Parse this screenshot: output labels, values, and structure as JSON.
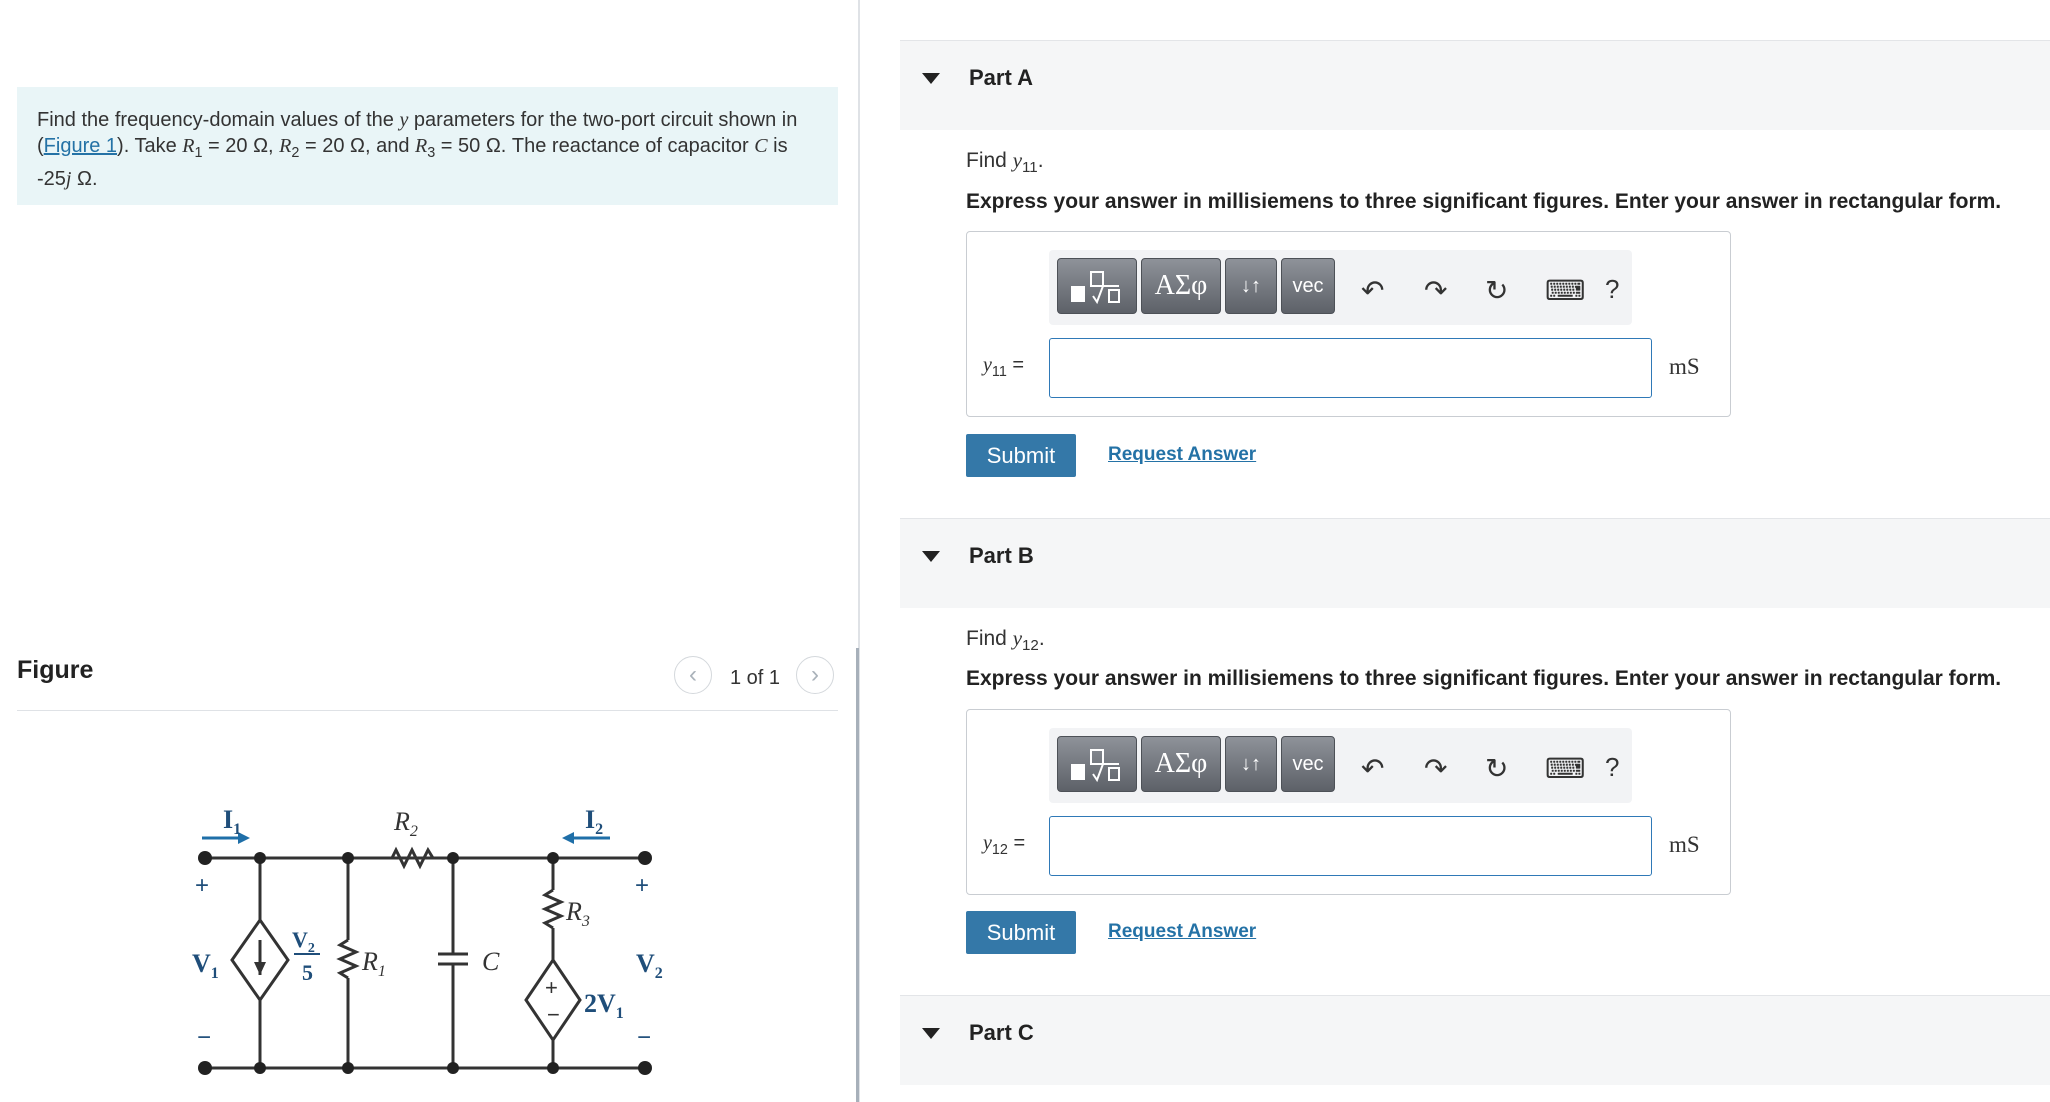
{
  "problem": {
    "text_1": "Find the frequency-domain values of the ",
    "y_symbol": "y",
    "text_2": " parameters for the two-port circuit shown in (",
    "figure_link": "Figure 1",
    "text_3": "). Take ",
    "r1_symbol": "R",
    "r1_sub": "1",
    "r1_value": " = 20 Ω, ",
    "r2_symbol": "R",
    "r2_sub": "2",
    "r2_value": " = 20 Ω, and ",
    "r3_symbol": "R",
    "r3_sub": "3",
    "r3_value": " = 50 Ω. The reactance of capacitor ",
    "c_symbol": "C",
    "text_4": " is -25",
    "j_symbol": "j",
    "text_5": " Ω."
  },
  "figure": {
    "title": "Figure",
    "pager": "1 of 1",
    "prev_glyph": "‹",
    "next_glyph": "›",
    "circuit": {
      "i1": "I",
      "i1_sub": "1",
      "i2": "I",
      "i2_sub": "2",
      "r2": "R",
      "r2_sub": "2",
      "r1": "R",
      "r1_sub": "1",
      "r3": "R",
      "r3_sub": "3",
      "c": "C",
      "v1": "V",
      "v1_sub": "1",
      "v2": "V",
      "v2_sub": "2",
      "src_num": "V",
      "src_num_sub": "2",
      "src_den": "5",
      "dep_gain": "2V",
      "dep_gain_sub": "1",
      "plus": "+",
      "minus": "−"
    }
  },
  "parts": [
    {
      "title": "Part A",
      "find_text": "Find ",
      "find_symbol": "y",
      "find_sub": "11",
      "find_end": ".",
      "instruction": "Express your answer in millisiemens to three significant figures. Enter your answer in rectangular form.",
      "label_symbol": "y",
      "label_sub": "11",
      "label_eq": " =",
      "input_value": "",
      "unit": "mS",
      "submit": "Submit",
      "request": "Request Answer"
    },
    {
      "title": "Part B",
      "find_text": "Find ",
      "find_symbol": "y",
      "find_sub": "12",
      "find_end": ".",
      "instruction": "Express your answer in millisiemens to three significant figures. Enter your answer in rectangular form.",
      "label_symbol": "y",
      "label_sub": "12",
      "label_eq": " =",
      "input_value": "",
      "unit": "mS",
      "submit": "Submit",
      "request": "Request Answer"
    },
    {
      "title": "Part C"
    }
  ],
  "toolbar": {
    "templates_icon": "template-icon",
    "greek_label": "ΑΣφ",
    "arrows_label": "↓↑",
    "vec_label": "vec",
    "undo_glyph": "↶",
    "redo_glyph": "↷",
    "reset_glyph": "↻",
    "keyboard_glyph": "⌨",
    "help_glyph": "?"
  },
  "colors": {
    "accent": "#3478a8",
    "link": "#2472a6",
    "problem_bg": "#e9f5f7",
    "circuit_label": "#1f4e7a"
  }
}
